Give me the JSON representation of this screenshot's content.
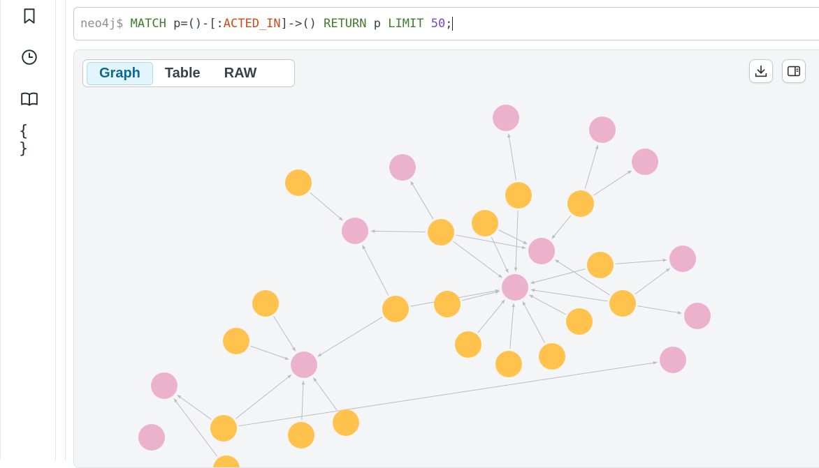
{
  "sidebar": {
    "items": [
      {
        "icon": "bookmark-icon",
        "name": "sidebar-item-favorites"
      },
      {
        "icon": "history-clock-icon",
        "name": "sidebar-item-history"
      },
      {
        "icon": "book-icon",
        "name": "sidebar-item-guides"
      },
      {
        "icon": "braces-icon",
        "name": "sidebar-item-parameters",
        "glyph": "{ }"
      }
    ]
  },
  "editor": {
    "prompt": "neo4j$",
    "tokens": {
      "match": "MATCH",
      "p_eq": "p=()-[:",
      "rel_type": "ACTED_IN",
      "arrow": "]->()",
      "return_kw": "RETURN",
      "p": "p",
      "limit_kw": "LIMIT",
      "limit_val": "50",
      "semicolon": ";"
    }
  },
  "result": {
    "tabs": [
      {
        "label": "Graph",
        "active": true
      },
      {
        "label": "Table",
        "active": false
      },
      {
        "label": "RAW",
        "active": false
      }
    ],
    "toolbar": {
      "download_icon": "download-icon",
      "panel_icon": "side-panel-icon"
    },
    "graph": {
      "colors": {
        "person": "#ffc24d",
        "movie": "#ecb2cb",
        "edge": "#b9bcc2"
      },
      "nodes": [
        {
          "id": "m1",
          "type": "movie"
        },
        {
          "id": "m2",
          "type": "movie"
        },
        {
          "id": "m3",
          "type": "movie"
        },
        {
          "id": "m4",
          "type": "movie"
        },
        {
          "id": "m5",
          "type": "movie"
        },
        {
          "id": "m6",
          "type": "movie"
        },
        {
          "id": "m7",
          "type": "movie"
        },
        {
          "id": "m8",
          "type": "movie"
        },
        {
          "id": "m9",
          "type": "movie"
        },
        {
          "id": "m10",
          "type": "movie"
        },
        {
          "id": "m11",
          "type": "movie"
        },
        {
          "id": "m12",
          "type": "movie"
        },
        {
          "id": "m13",
          "type": "movie"
        },
        {
          "id": "p1",
          "type": "person"
        },
        {
          "id": "p2",
          "type": "person"
        },
        {
          "id": "p3",
          "type": "person"
        },
        {
          "id": "p4",
          "type": "person"
        },
        {
          "id": "p5",
          "type": "person"
        },
        {
          "id": "p6",
          "type": "person"
        },
        {
          "id": "p7",
          "type": "person"
        },
        {
          "id": "p8",
          "type": "person"
        },
        {
          "id": "p9",
          "type": "person"
        },
        {
          "id": "p10",
          "type": "person"
        },
        {
          "id": "p11",
          "type": "person"
        },
        {
          "id": "p12",
          "type": "person"
        },
        {
          "id": "p13",
          "type": "person"
        },
        {
          "id": "p14",
          "type": "person"
        },
        {
          "id": "p15",
          "type": "person"
        },
        {
          "id": "p16",
          "type": "person"
        },
        {
          "id": "p17",
          "type": "person"
        },
        {
          "id": "p18",
          "type": "person"
        },
        {
          "id": "p19",
          "type": "person"
        }
      ],
      "edges": [
        [
          "p1",
          "m2"
        ],
        [
          "p2",
          "m2"
        ],
        [
          "p2",
          "m3"
        ],
        [
          "p2",
          "m5"
        ],
        [
          "p2",
          "m6"
        ],
        [
          "p3",
          "m1"
        ],
        [
          "p3",
          "m6"
        ],
        [
          "p4",
          "m5"
        ],
        [
          "p4",
          "m6"
        ],
        [
          "p5",
          "m4"
        ],
        [
          "p5",
          "m7"
        ],
        [
          "p5",
          "m5"
        ],
        [
          "p6",
          "m6"
        ],
        [
          "p6",
          "m8"
        ],
        [
          "p7",
          "m2"
        ],
        [
          "p7",
          "m10"
        ],
        [
          "p7",
          "m6"
        ],
        [
          "p8",
          "m6"
        ],
        [
          "p9",
          "m5"
        ],
        [
          "p9",
          "m8"
        ],
        [
          "p9",
          "m9"
        ],
        [
          "p9",
          "m6"
        ],
        [
          "p10",
          "m6"
        ],
        [
          "p11",
          "m6"
        ],
        [
          "p12",
          "m6"
        ],
        [
          "p13",
          "m6"
        ],
        [
          "p14",
          "m10"
        ],
        [
          "p15",
          "m10"
        ],
        [
          "p16",
          "m10"
        ],
        [
          "p17",
          "m10"
        ],
        [
          "p18",
          "m11"
        ],
        [
          "p18",
          "m12"
        ],
        [
          "p18",
          "m10"
        ],
        [
          "p19",
          "m12"
        ]
      ]
    }
  }
}
